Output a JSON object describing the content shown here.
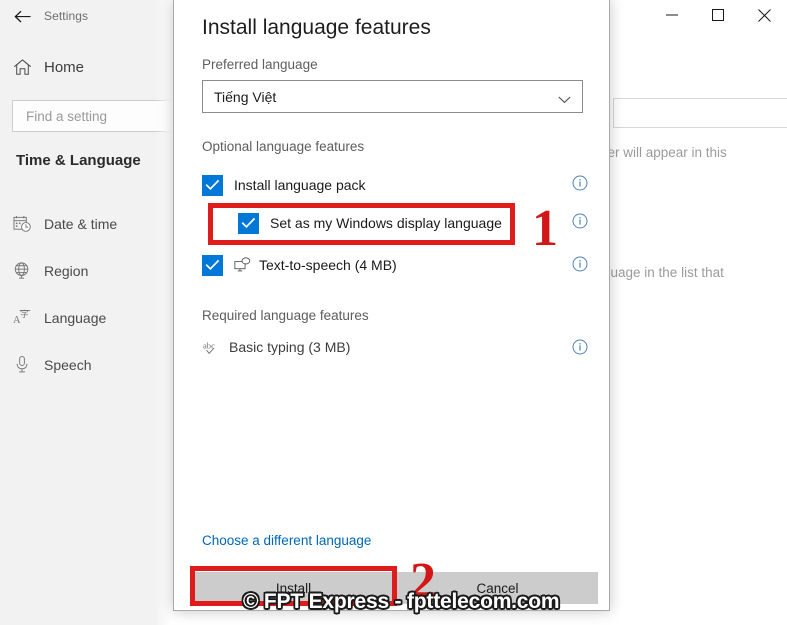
{
  "window": {
    "app_title": "Settings",
    "back_icon": "back-arrow-icon",
    "controls": {
      "minimize": "minimize-icon",
      "maximize": "maximize-icon",
      "close": "close-icon"
    }
  },
  "sidebar": {
    "home_label": "Home",
    "home_icon": "home-icon",
    "search": {
      "placeholder": "Find a setting",
      "value": ""
    },
    "section_title": "Time & Language",
    "items": [
      {
        "label": "Date & time",
        "icon": "calendar-clock-icon"
      },
      {
        "label": "Region",
        "icon": "globe-icon"
      },
      {
        "label": "Language",
        "icon": "translate-icon"
      },
      {
        "label": "Speech",
        "icon": "microphone-icon"
      }
    ]
  },
  "background": {
    "text_fragment_1": "rer will appear in this",
    "text_fragment_2": "guage in the list that",
    "feature_icons": [
      "translate-icon",
      "text-to-speech-icon",
      "speech-icon",
      "handwriting-icon",
      "basic-typing-icon"
    ]
  },
  "dialog": {
    "title": "Install language features",
    "preferred_label": "Preferred language",
    "preferred_value": "Tiếng Việt",
    "dropdown_icon": "chevron-down-icon",
    "optional_label": "Optional language features",
    "optional_features": [
      {
        "label": "Install language pack",
        "checked": true,
        "indent": false,
        "icon": null,
        "info_icon": "info-icon"
      },
      {
        "label": "Set as my Windows display language",
        "checked": true,
        "indent": true,
        "icon": null,
        "info_icon": "info-icon"
      },
      {
        "label": "Text-to-speech (4 MB)",
        "checked": true,
        "indent": false,
        "icon": "text-to-speech-icon",
        "info_icon": "info-icon"
      }
    ],
    "required_label": "Required language features",
    "required_features": [
      {
        "label": "Basic typing (3 MB)",
        "icon": "basic-typing-icon",
        "info_icon": "info-icon"
      }
    ],
    "choose_different_link": "Choose a different language",
    "install_button": "Install",
    "cancel_button": "Cancel"
  },
  "annotations": {
    "step_one": "1",
    "step_two": "2",
    "highlight_color": "#e01b1b",
    "number_color": "#d31717"
  },
  "watermark": {
    "text": "© FPT Express - fpttelecom.com"
  },
  "colors": {
    "accent": "#0078d7",
    "link": "#0067b8",
    "sidebar_bg": "#f2f2f2",
    "button_bg": "#cccccc"
  }
}
